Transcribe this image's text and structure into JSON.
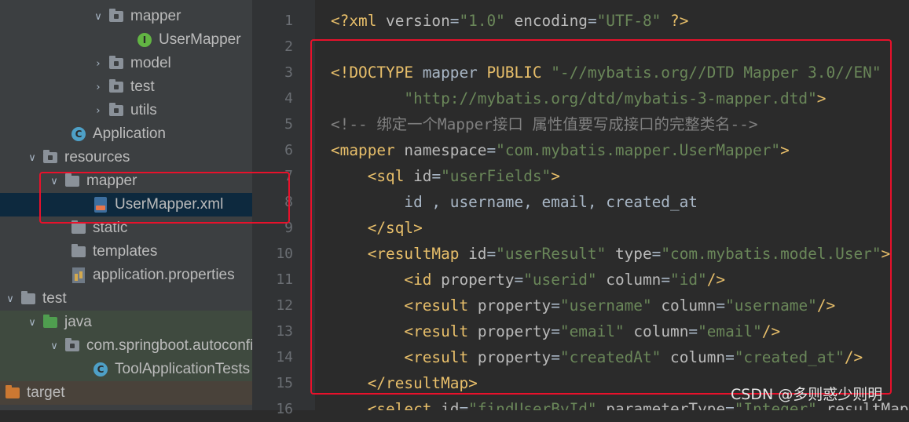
{
  "tree": [
    {
      "label": "mapper",
      "icon": "folder-icon",
      "expanded": true
    },
    {
      "label": "UserMapper",
      "icon": "interface-icon",
      "expanded": null
    },
    {
      "label": "model",
      "icon": "folder-icon",
      "expanded": false
    },
    {
      "label": "test",
      "icon": "folder-icon",
      "expanded": false
    },
    {
      "label": "utils",
      "icon": "folder-icon",
      "expanded": false
    },
    {
      "label": "Application",
      "icon": "class-icon",
      "expanded": null
    },
    {
      "label": "resources",
      "icon": "resources-folder-icon",
      "expanded": true
    },
    {
      "label": "mapper",
      "icon": "folder-icon",
      "expanded": true
    },
    {
      "label": "UserMapper.xml",
      "icon": "xml-file-icon",
      "expanded": null,
      "selected": true
    },
    {
      "label": "static",
      "icon": "folder-icon",
      "expanded": null
    },
    {
      "label": "templates",
      "icon": "folder-icon",
      "expanded": null
    },
    {
      "label": "application.properties",
      "icon": "properties-file-icon",
      "expanded": null
    },
    {
      "label": "test",
      "icon": "folder-icon",
      "expanded": true
    },
    {
      "label": "java",
      "icon": "test-source-folder-icon",
      "expanded": true
    },
    {
      "label": "com.springboot.autoconfig",
      "icon": "package-icon",
      "expanded": true
    },
    {
      "label": "ToolApplicationTests",
      "icon": "class-icon",
      "expanded": null
    },
    {
      "label": "target",
      "icon": "excluded-folder-icon",
      "expanded": false
    }
  ],
  "line_numbers": [
    "1",
    "2",
    "3",
    "4",
    "5",
    "6",
    "7",
    "8",
    "9",
    "10",
    "11",
    "12",
    "13",
    "14",
    "15",
    "16"
  ],
  "code": [
    [
      [
        "t-tag",
        "<?xml "
      ],
      [
        "t-attr",
        "version"
      ],
      [
        "t-pl",
        "="
      ],
      [
        "t-val",
        "\"1.0\""
      ],
      [
        "t-pl",
        " "
      ],
      [
        "t-attr",
        "encoding"
      ],
      [
        "t-pl",
        "="
      ],
      [
        "t-val",
        "\"UTF-8\""
      ],
      [
        "t-pl",
        " "
      ],
      [
        "t-tag",
        "?>"
      ]
    ],
    [],
    [
      [
        "t-doc",
        "<!DOCTYPE "
      ],
      [
        "t-pl",
        "mapper "
      ],
      [
        "t-doc",
        "PUBLIC "
      ],
      [
        "t-val",
        "\"-//mybatis.org//DTD Mapper 3.0//EN\""
      ]
    ],
    [
      [
        "t-pl",
        "        "
      ],
      [
        "t-val",
        "\"http://mybatis.org/dtd/mybatis-3-mapper.dtd\""
      ],
      [
        "t-doc",
        ">"
      ]
    ],
    [
      [
        "t-com",
        "<!-- 绑定一个Mapper接口 属性值要写成接口的完整类名-->"
      ]
    ],
    [
      [
        "t-tag",
        "<mapper "
      ],
      [
        "t-attr",
        "namespace"
      ],
      [
        "t-pl",
        "="
      ],
      [
        "t-val",
        "\"com.mybatis.mapper.UserMapper\""
      ],
      [
        "t-tag",
        ">"
      ]
    ],
    [
      [
        "t-pl",
        "    "
      ],
      [
        "t-tag",
        "<sql "
      ],
      [
        "t-attr",
        "id"
      ],
      [
        "t-pl",
        "="
      ],
      [
        "t-val",
        "\"userFields\""
      ],
      [
        "t-tag",
        ">"
      ]
    ],
    [
      [
        "t-pl",
        "        id , username, email, created_at"
      ]
    ],
    [
      [
        "t-pl",
        "    "
      ],
      [
        "t-tag",
        "</sql>"
      ]
    ],
    [
      [
        "t-pl",
        "    "
      ],
      [
        "t-tag",
        "<resultMap "
      ],
      [
        "t-attr",
        "id"
      ],
      [
        "t-pl",
        "="
      ],
      [
        "t-val",
        "\"userResult\""
      ],
      [
        "t-pl",
        " "
      ],
      [
        "t-attr",
        "type"
      ],
      [
        "t-pl",
        "="
      ],
      [
        "t-val",
        "\"com.mybatis.model.User\""
      ],
      [
        "t-tag",
        ">"
      ]
    ],
    [
      [
        "t-pl",
        "        "
      ],
      [
        "t-tag",
        "<id "
      ],
      [
        "t-attr",
        "property"
      ],
      [
        "t-pl",
        "="
      ],
      [
        "t-val",
        "\"userid\""
      ],
      [
        "t-pl",
        " "
      ],
      [
        "t-attr",
        "column"
      ],
      [
        "t-pl",
        "="
      ],
      [
        "t-val",
        "\"id\""
      ],
      [
        "t-tag",
        "/>"
      ]
    ],
    [
      [
        "t-pl",
        "        "
      ],
      [
        "t-tag",
        "<result "
      ],
      [
        "t-attr",
        "property"
      ],
      [
        "t-pl",
        "="
      ],
      [
        "t-val",
        "\"username\""
      ],
      [
        "t-pl",
        " "
      ],
      [
        "t-attr",
        "column"
      ],
      [
        "t-pl",
        "="
      ],
      [
        "t-val",
        "\"username\""
      ],
      [
        "t-tag",
        "/>"
      ]
    ],
    [
      [
        "t-pl",
        "        "
      ],
      [
        "t-tag",
        "<result "
      ],
      [
        "t-attr",
        "property"
      ],
      [
        "t-pl",
        "="
      ],
      [
        "t-val",
        "\"email\""
      ],
      [
        "t-pl",
        " "
      ],
      [
        "t-attr",
        "column"
      ],
      [
        "t-pl",
        "="
      ],
      [
        "t-val",
        "\"email\""
      ],
      [
        "t-tag",
        "/>"
      ]
    ],
    [
      [
        "t-pl",
        "        "
      ],
      [
        "t-tag",
        "<result "
      ],
      [
        "t-attr",
        "property"
      ],
      [
        "t-pl",
        "="
      ],
      [
        "t-val",
        "\"createdAt\""
      ],
      [
        "t-pl",
        " "
      ],
      [
        "t-attr",
        "column"
      ],
      [
        "t-pl",
        "="
      ],
      [
        "t-val",
        "\"created_at\""
      ],
      [
        "t-tag",
        "/>"
      ]
    ],
    [
      [
        "t-pl",
        "    "
      ],
      [
        "t-tag",
        "</resultMap>"
      ]
    ],
    [
      [
        "t-pl",
        "    "
      ],
      [
        "t-tag",
        "<select "
      ],
      [
        "t-attr",
        "id"
      ],
      [
        "t-pl",
        "="
      ],
      [
        "t-val",
        "\"findUserById\""
      ],
      [
        "t-pl",
        " "
      ],
      [
        "t-attr",
        "parameterType"
      ],
      [
        "t-pl",
        "="
      ],
      [
        "t-val",
        "\"Integer\""
      ],
      [
        "t-pl",
        " "
      ],
      [
        "t-attr",
        "resultMap"
      ]
    ]
  ],
  "watermark": "CSDN @多则惑少则明",
  "colors": {
    "annotation": "#e8112b",
    "selection": "#0d293e",
    "tag": "#e8bf6a",
    "string": "#6a8759",
    "comment": "#808080"
  }
}
